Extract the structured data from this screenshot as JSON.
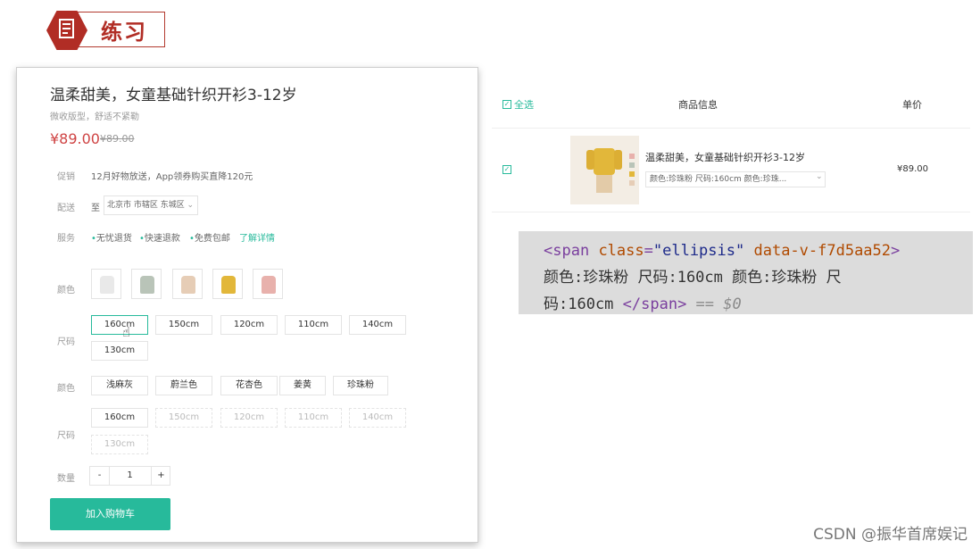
{
  "header": {
    "title": "练习"
  },
  "product": {
    "title": "温柔甜美，女童基础针织开衫3-12岁",
    "subtitle": "微收版型，舒适不紧勒",
    "price": "¥89.00",
    "old_price": "¥89.00",
    "promo_label": "促销",
    "promo_text": "12月好物放送，App领券购买直降120元",
    "ship_label": "配送",
    "ship_to": "至",
    "address": "北京市 市辖区 东城区",
    "service_label": "服务",
    "services": [
      "无忧退货",
      "快速退款",
      "免费包邮"
    ],
    "service_link": "了解详情",
    "color_label": "颜色",
    "size_label": "尺码",
    "color_label2": "颜色",
    "size_label2": "尺码",
    "sizes": [
      "160cm",
      "150cm",
      "120cm",
      "110cm",
      "140cm",
      "130cm"
    ],
    "colors": [
      "浅麻灰",
      "蔚兰色",
      "花杏色",
      "姜黄",
      "珍珠粉"
    ],
    "sizes2": [
      "160cm",
      "150cm",
      "120cm",
      "110cm",
      "140cm",
      "130cm"
    ],
    "qty_label": "数量",
    "qty_minus": "-",
    "qty": "1",
    "qty_plus": "+",
    "add_to_cart": "加入购物车",
    "thumb_colors": [
      "#e9e9e9",
      "#b9c4b8",
      "#e6cdb6",
      "#e2b73a",
      "#e8b1ac"
    ]
  },
  "cart": {
    "select_all": "全选",
    "col_info": "商品信息",
    "col_price": "单价",
    "item_name": "温柔甜美，女童基础针织开衫3-12岁",
    "item_spec": "颜色:珍珠粉 尺码:160cm 颜色:珍珠...",
    "item_price": "¥89.00"
  },
  "code": {
    "open_tag": "<span",
    "attr1": "class",
    "val1": "\"ellipsis\"",
    "attr2": "data-v-f7d5aa52",
    "close": ">",
    "text1": "颜色:珍珠粉 尺码:160cm 颜色:珍珠粉 尺",
    "text2": "码:160cm ",
    "end_tag": "</span>",
    "eq": " == $0"
  },
  "watermark": "CSDN @振华首席娱记"
}
